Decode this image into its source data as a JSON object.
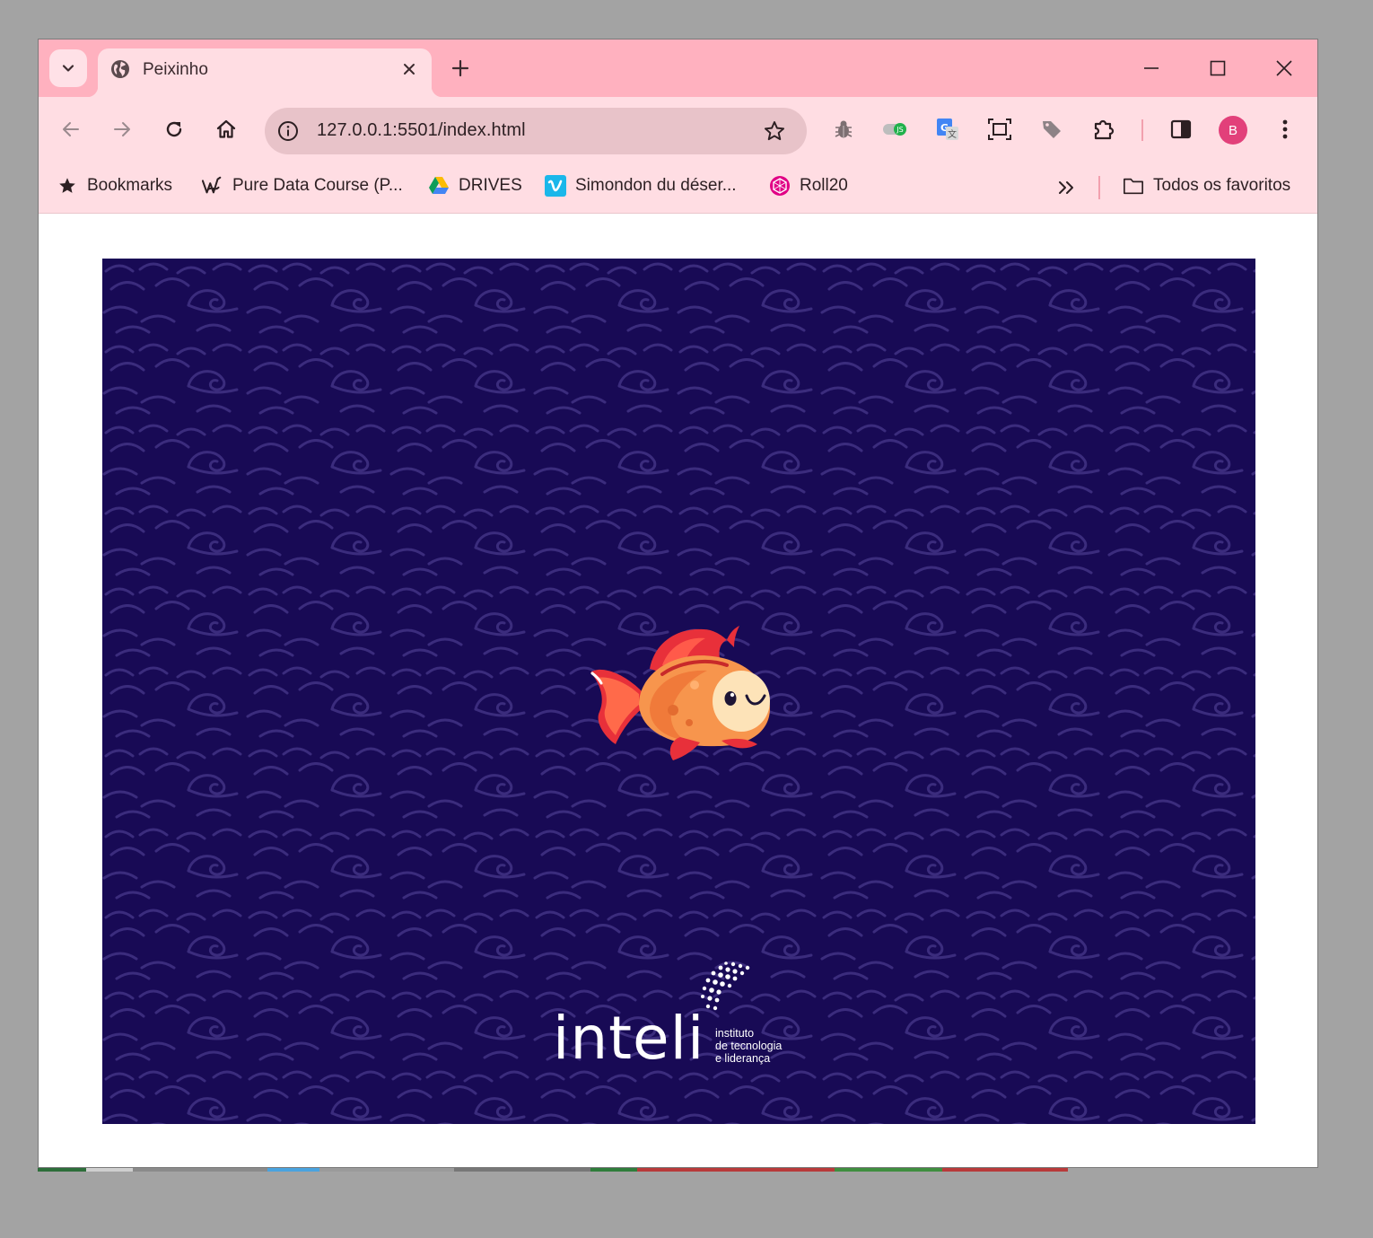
{
  "browser": {
    "tab": {
      "title": "Peixinho"
    },
    "omnibox": {
      "url": "127.0.0.1:5501/index.html"
    },
    "profile_initial": "B",
    "bookmarks": [
      {
        "label": "Bookmarks",
        "icon": "star-icon"
      },
      {
        "label": "Pure Data Course (P...",
        "icon": "puredata-icon"
      },
      {
        "label": "DRIVES",
        "icon": "google-drive-icon"
      },
      {
        "label": "Simondon du déser...",
        "icon": "vimeo-icon"
      },
      {
        "label": "Roll20",
        "icon": "roll20-icon"
      }
    ],
    "all_bookmarks_label": "Todos os favoritos",
    "colors": {
      "tab_strip": "#ffb1bf",
      "toolbar": "#ffdde3",
      "omnibox": "#e8c3c9",
      "avatar": "#e2407a"
    }
  },
  "game": {
    "background_color": "#180a55",
    "wave_color": "#3a2a7a",
    "sprite": "fish",
    "logo": {
      "word": "inteli",
      "subtitle_lines": [
        "instituto",
        "de tecnologia",
        "e liderança"
      ]
    }
  }
}
